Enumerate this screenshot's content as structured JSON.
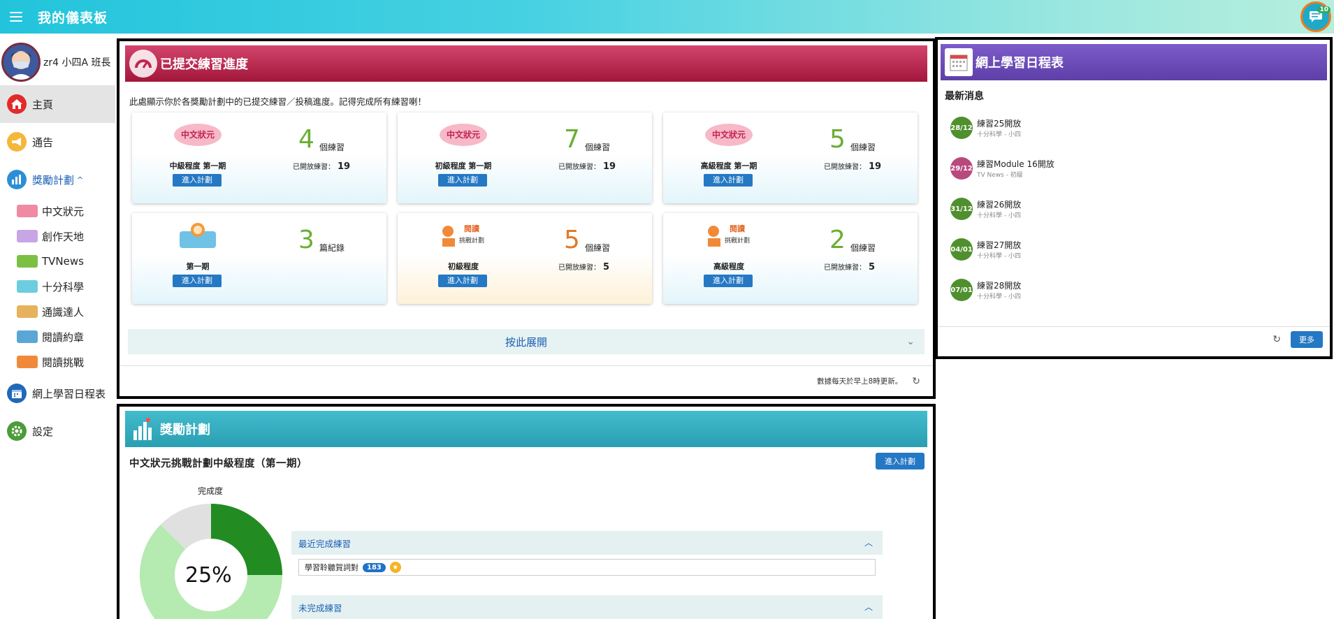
{
  "header": {
    "title": "我的儀表板",
    "message_badge": "10"
  },
  "sidebar": {
    "user": "zr4 小四A 班長",
    "nav": {
      "home": "主頁",
      "notice": "通告",
      "rewards": "獎勵計劃",
      "schedule": "網上學習日程表",
      "settings": "設定"
    },
    "sub_items": [
      "中文狀元",
      "創作天地",
      "TVNews",
      "十分科學",
      "通識達人",
      "閱讀約章",
      "閱讀挑戰"
    ]
  },
  "progress_panel": {
    "title": "已提交練習進度",
    "intro": "此處顯示你於各獎勵計劃中的已提交練習／投稿進度。記得完成所有練習喇！",
    "enter_label": "進入計劃",
    "cards": [
      {
        "level": "中級程度 第一期",
        "count": "4",
        "unit": "個練習",
        "open_label": "已開放練習：",
        "open_count": "19"
      },
      {
        "level": "初級程度 第一期",
        "count": "7",
        "unit": "個練習",
        "open_label": "已開放練習：",
        "open_count": "19"
      },
      {
        "level": "高級程度 第一期",
        "count": "5",
        "unit": "個練習",
        "open_label": "已開放練習：",
        "open_count": "19"
      },
      {
        "level": "第一期",
        "count": "3",
        "unit": "篇紀錄",
        "open_label": "",
        "open_count": ""
      },
      {
        "level": "初級程度",
        "count": "5",
        "unit": "個練習",
        "open_label": "已開放練習：",
        "open_count": "5"
      },
      {
        "level": "高級程度",
        "count": "2",
        "unit": "個練習",
        "open_label": "已開放練習：",
        "open_count": "5"
      }
    ],
    "logo_texts": {
      "cn": "中文狀元",
      "read": "閱讀",
      "challenge": "挑戰計劃"
    },
    "expand_label": "按此展開",
    "update_note": "數據每天於早上8時更新。"
  },
  "schedule_panel": {
    "title": "網上學習日程表",
    "latest": "最新消息",
    "news": [
      {
        "date": "28/12",
        "title": "練習25開放",
        "sub": "十分科學 - 小四",
        "color": "#4f8f2e"
      },
      {
        "date": "29/12",
        "title": "練習Module 16開放",
        "sub": "TV News - 初級",
        "color": "#b8497c"
      },
      {
        "date": "31/12",
        "title": "練習26開放",
        "sub": "十分科學 - 小四",
        "color": "#4f8f2e"
      },
      {
        "date": "04/01",
        "title": "練習27開放",
        "sub": "十分科學 - 小四",
        "color": "#4f8f2e"
      },
      {
        "date": "07/01",
        "title": "練習28開放",
        "sub": "十分科學 - 小四",
        "color": "#4f8f2e"
      }
    ],
    "more_label": "更多"
  },
  "reward_panel": {
    "title": "獎勵計劃",
    "plan_title": "中文狀元挑戰計劃中級程度（第一期）",
    "enter_label": "進入計劃",
    "completion_label": "完成度",
    "completion_pct": "25%",
    "completion_fraction": 0.25,
    "recent_done": "最近完成練習",
    "recent_item": "學習聆聽賀詞對",
    "recent_count": "183",
    "not_done": "未完成練習"
  },
  "colors": {
    "accent": "#2478c4",
    "green_number": "#6aaf33",
    "orange_number": "#e17a27",
    "donut_done": "#228b22",
    "donut_pending": "#b5eab0",
    "donut_rest": "#e0e0e0"
  }
}
